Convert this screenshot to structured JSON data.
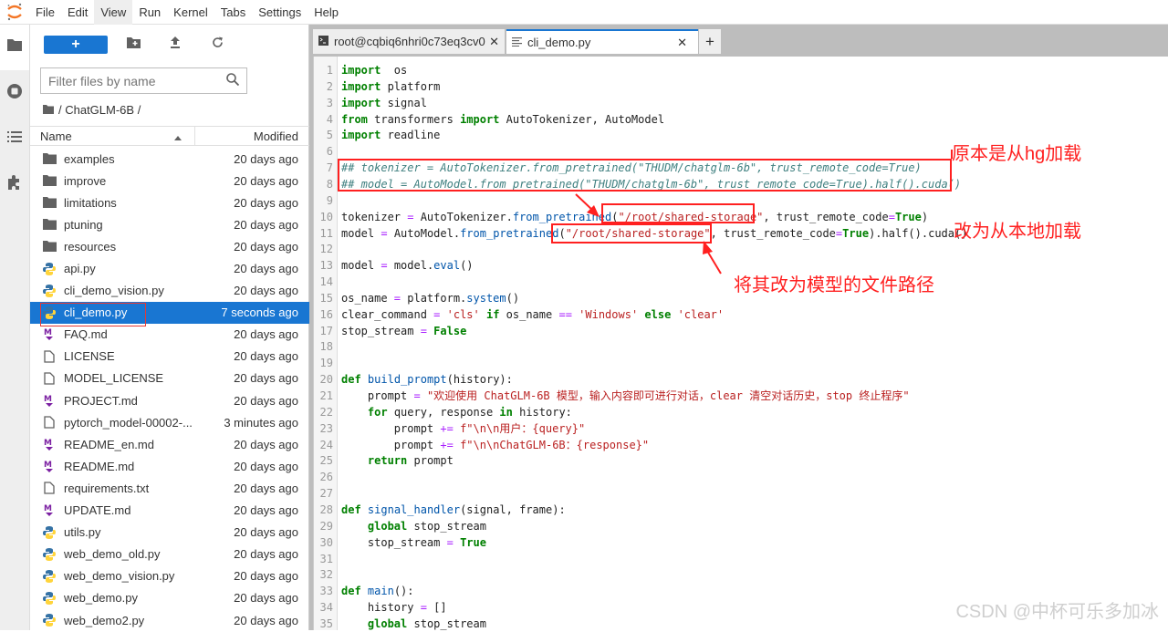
{
  "menubar": {
    "items": [
      "File",
      "Edit",
      "View",
      "Run",
      "Kernel",
      "Tabs",
      "Settings",
      "Help"
    ],
    "active": "View"
  },
  "leftbar": {
    "tabs": [
      "folder-icon",
      "running-icon",
      "toc-icon",
      "extension-icon"
    ]
  },
  "filebrowser": {
    "new_label": "+",
    "filter_placeholder": "Filter files by name",
    "breadcrumb": "/ ChatGLM-6B /",
    "header_name": "Name",
    "header_modified": "Modified",
    "files": [
      {
        "name": "examples",
        "modified": "20 days ago",
        "type": "folder"
      },
      {
        "name": "improve",
        "modified": "20 days ago",
        "type": "folder"
      },
      {
        "name": "limitations",
        "modified": "20 days ago",
        "type": "folder"
      },
      {
        "name": "ptuning",
        "modified": "20 days ago",
        "type": "folder"
      },
      {
        "name": "resources",
        "modified": "20 days ago",
        "type": "folder"
      },
      {
        "name": "api.py",
        "modified": "20 days ago",
        "type": "python"
      },
      {
        "name": "cli_demo_vision.py",
        "modified": "20 days ago",
        "type": "python"
      },
      {
        "name": "cli_demo.py",
        "modified": "7 seconds ago",
        "type": "python",
        "selected": true
      },
      {
        "name": "FAQ.md",
        "modified": "20 days ago",
        "type": "markdown"
      },
      {
        "name": "LICENSE",
        "modified": "20 days ago",
        "type": "file"
      },
      {
        "name": "MODEL_LICENSE",
        "modified": "20 days ago",
        "type": "file"
      },
      {
        "name": "PROJECT.md",
        "modified": "20 days ago",
        "type": "markdown"
      },
      {
        "name": "pytorch_model-00002-...",
        "modified": "3 minutes ago",
        "type": "file"
      },
      {
        "name": "README_en.md",
        "modified": "20 days ago",
        "type": "markdown"
      },
      {
        "name": "README.md",
        "modified": "20 days ago",
        "type": "markdown"
      },
      {
        "name": "requirements.txt",
        "modified": "20 days ago",
        "type": "file"
      },
      {
        "name": "UPDATE.md",
        "modified": "20 days ago",
        "type": "markdown"
      },
      {
        "name": "utils.py",
        "modified": "20 days ago",
        "type": "python"
      },
      {
        "name": "web_demo_old.py",
        "modified": "20 days ago",
        "type": "python"
      },
      {
        "name": "web_demo_vision.py",
        "modified": "20 days ago",
        "type": "python"
      },
      {
        "name": "web_demo.py",
        "modified": "20 days ago",
        "type": "python"
      },
      {
        "name": "web_demo2.py",
        "modified": "20 days ago",
        "type": "python"
      }
    ]
  },
  "tabs": [
    {
      "label": "root@cqbiq6nhri0c73eq3cv0",
      "icon": "terminal-icon",
      "current": false
    },
    {
      "label": "cli_demo.py",
      "icon": "text-file-icon",
      "current": true
    }
  ],
  "new_tab_label": "+",
  "code_lines": [
    [
      [
        "kw",
        "import"
      ],
      [
        "",
        "  os"
      ]
    ],
    [
      [
        "kw",
        "import"
      ],
      [
        "",
        " platform"
      ]
    ],
    [
      [
        "kw",
        "import"
      ],
      [
        "",
        " signal"
      ]
    ],
    [
      [
        "kw",
        "from"
      ],
      [
        "",
        " transformers "
      ],
      [
        "kw",
        "import"
      ],
      [
        "",
        " AutoTokenizer, AutoModel"
      ]
    ],
    [
      [
        "kw",
        "import"
      ],
      [
        "",
        " readline"
      ]
    ],
    [],
    [
      [
        "cmt",
        "## tokenizer = AutoTokenizer.from_pretrained(\"THUDM/chatglm-6b\", trust_remote_code=True)"
      ]
    ],
    [
      [
        "cmt",
        "## model = AutoModel.from_pretrained(\"THUDM/chatglm-6b\", trust_remote_code=True).half().cuda()"
      ]
    ],
    [],
    [
      [
        "",
        "tokenizer "
      ],
      [
        "op",
        "="
      ],
      [
        "",
        " AutoTokenizer."
      ],
      [
        "fn",
        "from_pretrained"
      ],
      [
        "",
        "("
      ],
      [
        "str",
        "\"/root/shared-storage\""
      ],
      [
        "",
        ", trust_remote_code"
      ],
      [
        "op",
        "="
      ],
      [
        "cn",
        "True"
      ],
      [
        "",
        ")"
      ]
    ],
    [
      [
        "",
        "model "
      ],
      [
        "op",
        "="
      ],
      [
        "",
        " AutoModel."
      ],
      [
        "fn",
        "from_pretrained"
      ],
      [
        "",
        "("
      ],
      [
        "str",
        "\"/root/shared-storage\""
      ],
      [
        "",
        ", trust_remote_code"
      ],
      [
        "op",
        "="
      ],
      [
        "cn",
        "True"
      ],
      [
        "",
        ")."
      ],
      [
        "",
        "half().cuda()"
      ]
    ],
    [],
    [
      [
        "",
        "model "
      ],
      [
        "op",
        "="
      ],
      [
        "",
        " model."
      ],
      [
        "fn",
        "eval"
      ],
      [
        "",
        "()"
      ]
    ],
    [],
    [
      [
        "",
        "os_name "
      ],
      [
        "op",
        "="
      ],
      [
        "",
        " platform."
      ],
      [
        "fn",
        "system"
      ],
      [
        "",
        "()"
      ]
    ],
    [
      [
        "",
        "clear_command "
      ],
      [
        "op",
        "="
      ],
      [
        "",
        " "
      ],
      [
        "str",
        "'cls'"
      ],
      [
        "",
        " "
      ],
      [
        "kw",
        "if"
      ],
      [
        "",
        " os_name "
      ],
      [
        "op",
        "=="
      ],
      [
        "",
        " "
      ],
      [
        "str",
        "'Windows'"
      ],
      [
        "",
        " "
      ],
      [
        "kw",
        "else"
      ],
      [
        "",
        " "
      ],
      [
        "str",
        "'clear'"
      ]
    ],
    [
      [
        "",
        "stop_stream "
      ],
      [
        "op",
        "="
      ],
      [
        "",
        " "
      ],
      [
        "cn",
        "False"
      ]
    ],
    [],
    [],
    [
      [
        "kw",
        "def"
      ],
      [
        "",
        " "
      ],
      [
        "fn",
        "build_prompt"
      ],
      [
        "",
        "(history):"
      ]
    ],
    [
      [
        "",
        "    prompt "
      ],
      [
        "op",
        "="
      ],
      [
        "",
        " "
      ],
      [
        "str",
        "\"欢迎使用 ChatGLM-6B 模型，输入内容即可进行对话，clear 清空对话历史，stop 终止程序\""
      ]
    ],
    [
      [
        "",
        "    "
      ],
      [
        "kw",
        "for"
      ],
      [
        "",
        " query, response "
      ],
      [
        "kw",
        "in"
      ],
      [
        "",
        " history:"
      ]
    ],
    [
      [
        "",
        "        prompt "
      ],
      [
        "op",
        "+="
      ],
      [
        "",
        " "
      ],
      [
        "str",
        "f\"\\n\\n用户：{query}\""
      ]
    ],
    [
      [
        "",
        "        prompt "
      ],
      [
        "op",
        "+="
      ],
      [
        "",
        " "
      ],
      [
        "str",
        "f\"\\n\\nChatGLM-6B：{response}\""
      ]
    ],
    [
      [
        "",
        "    "
      ],
      [
        "kw",
        "return"
      ],
      [
        "",
        " prompt"
      ]
    ],
    [],
    [],
    [
      [
        "kw",
        "def"
      ],
      [
        "",
        " "
      ],
      [
        "fn",
        "signal_handler"
      ],
      [
        "",
        "(signal, frame):"
      ]
    ],
    [
      [
        "",
        "    "
      ],
      [
        "kw",
        "global"
      ],
      [
        "",
        " stop_stream"
      ]
    ],
    [
      [
        "",
        "    stop_stream "
      ],
      [
        "op",
        "="
      ],
      [
        "",
        " "
      ],
      [
        "cn",
        "True"
      ]
    ],
    [],
    [],
    [
      [
        "kw",
        "def"
      ],
      [
        "",
        " "
      ],
      [
        "fn",
        "main"
      ],
      [
        "",
        "():"
      ]
    ],
    [
      [
        "",
        "    history "
      ],
      [
        "op",
        "="
      ],
      [
        "",
        " []"
      ]
    ],
    [
      [
        "",
        "    "
      ],
      [
        "kw",
        "global"
      ],
      [
        "",
        " stop_stream"
      ]
    ]
  ],
  "annotations": {
    "hg_note": "原本是从hg加载",
    "local_note": "改为从本地加载",
    "path_note": "将其改为模型的文件路径",
    "color": "#ff2020"
  },
  "watermark": "CSDN @中杯可乐多加冰",
  "colors": {
    "accent": "#1976d2",
    "annotation": "#ff2020"
  }
}
